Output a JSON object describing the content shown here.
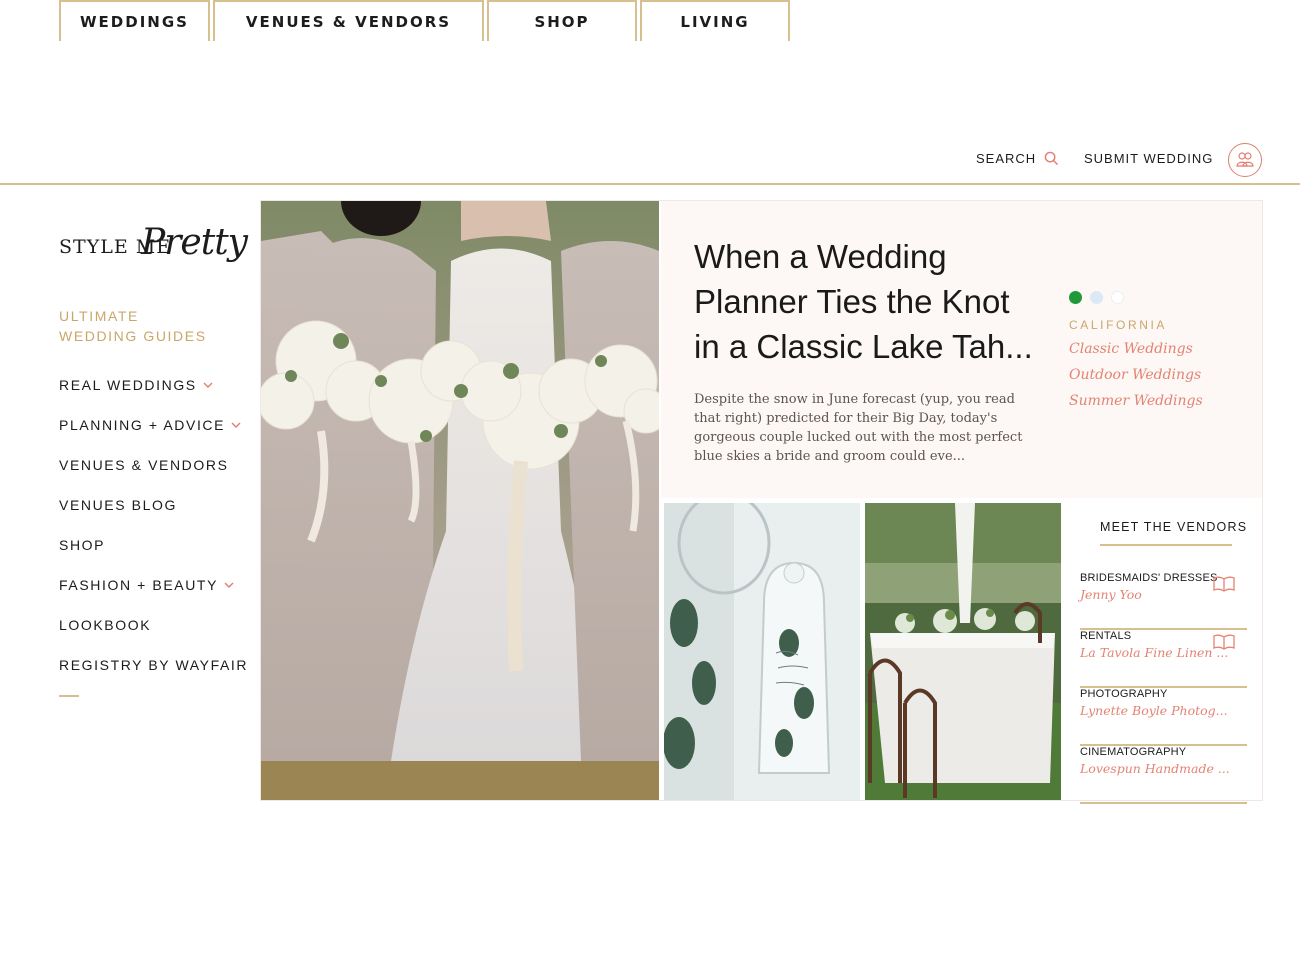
{
  "topnav": {
    "tabs": [
      "WEDDINGS",
      "VENUES & VENDORS",
      "SHOP",
      "LIVING"
    ],
    "search_label": "SEARCH",
    "submit_label": "SUBMIT WEDDING"
  },
  "logo": {
    "word1": "STYLE ME",
    "word2": "Pretty"
  },
  "sidebar": {
    "items": [
      {
        "label": "ULTIMATE WEDDING GUIDES"
      },
      {
        "label": "REAL WEDDINGS"
      },
      {
        "label": "PLANNING + ADVICE"
      },
      {
        "label": "VENUES & VENDORS"
      },
      {
        "label": "VENUES BLOG"
      },
      {
        "label": "SHOP"
      },
      {
        "label": "FASHION + BEAUTY"
      },
      {
        "label": "LOOKBOOK"
      },
      {
        "label": "REGISTRY BY WAYFAIR"
      }
    ]
  },
  "feature": {
    "headline": "When a Wedding Planner Ties the Knot in a Classic Lake Tah...",
    "excerpt": "Despite the snow in June forecast (yup, you read that right) predicted for their Big Day,  today's gorgeous couple lucked out with the most perfect blue skies a bride and groom could eve...",
    "region": "CALIFORNIA",
    "tags": [
      "Classic Weddings",
      "Outdoor Weddings",
      "Summer Weddings"
    ],
    "dot_colors": [
      "#1f9a3a",
      "#dce9f5",
      "#ffffff"
    ]
  },
  "vendors": {
    "title": "MEET THE VENDORS",
    "list": [
      {
        "category": "BRIDESMAIDS' DRESSES",
        "name": "Jenny Yoo"
      },
      {
        "category": "RENTALS",
        "name": "La Tavola Fine Linen ..."
      },
      {
        "category": "PHOTOGRAPHY",
        "name": "Lynette Boyle Photog..."
      },
      {
        "category": "CINEMATOGRAPHY",
        "name": "Lovespun Handmade ..."
      }
    ]
  },
  "colors": {
    "gold": "#d7c08f",
    "coral": "#e38372",
    "blush": "#fdf8f5"
  }
}
